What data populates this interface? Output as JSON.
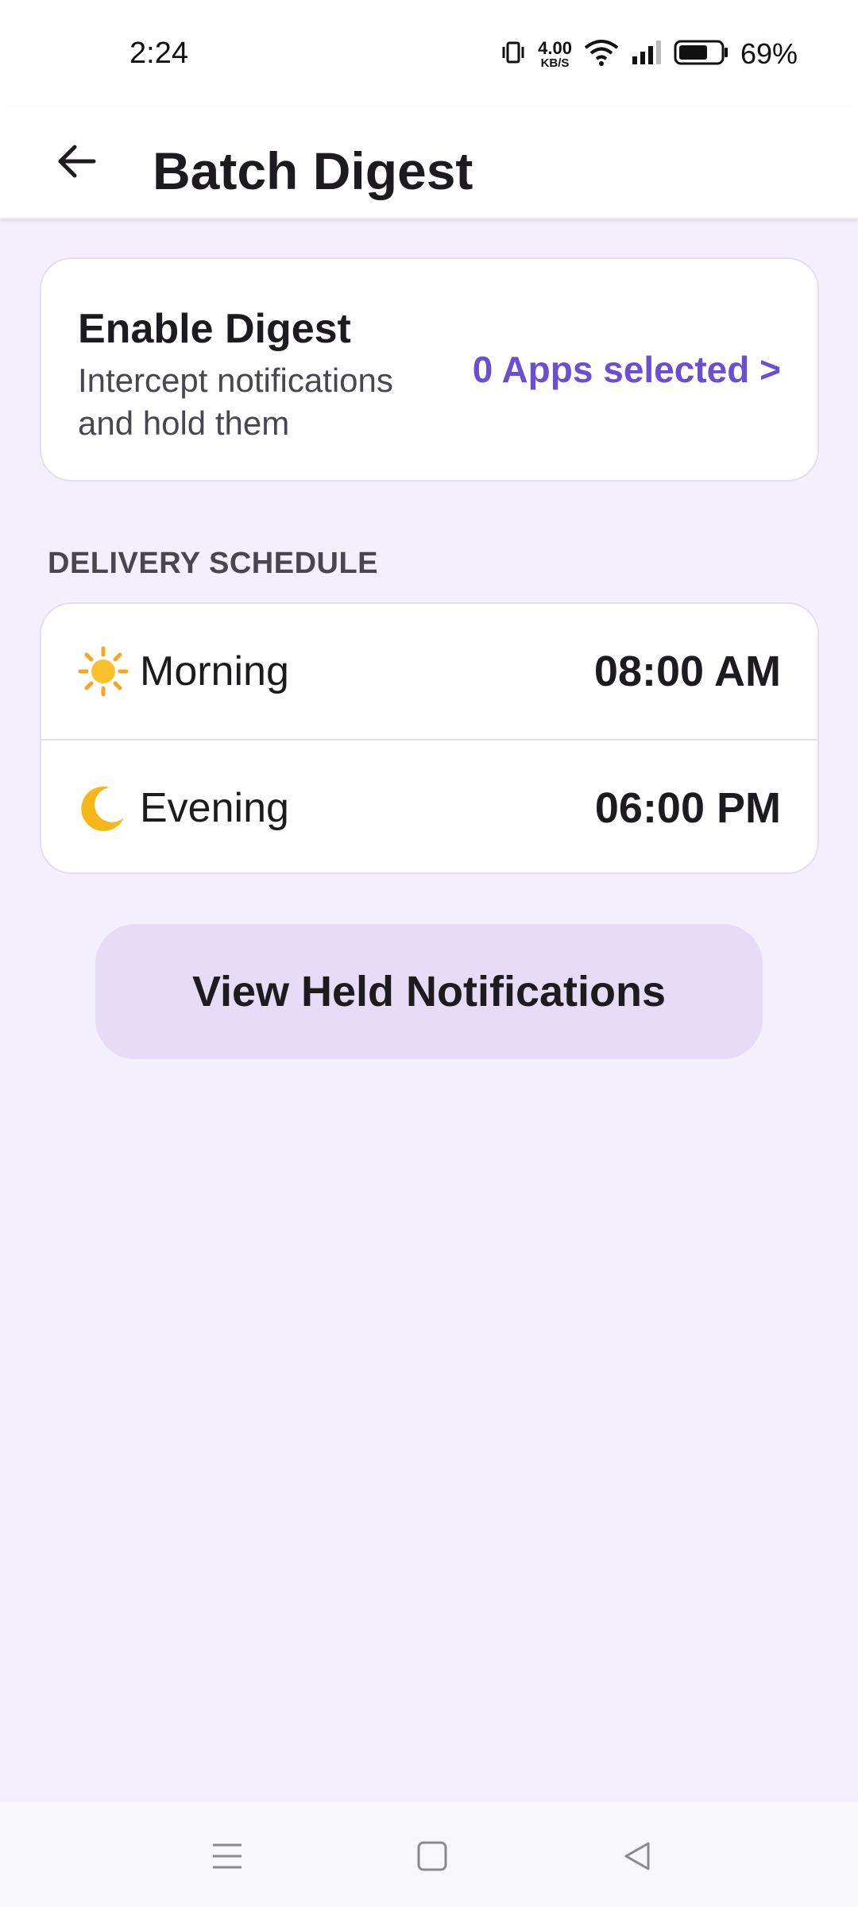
{
  "status_bar": {
    "time": "2:24",
    "net_speed_value": "4.00",
    "net_speed_unit": "KB/S",
    "battery_percent": "69%"
  },
  "app_bar": {
    "title": "Batch Digest",
    "back_icon": "arrow-left-icon"
  },
  "enable_card": {
    "title": "Enable Digest",
    "subtitle": "Intercept notifications and hold them",
    "apps_selected": "0 Apps selected >"
  },
  "schedule": {
    "section_label": "DELIVERY SCHEDULE",
    "rows": [
      {
        "icon": "sun-icon",
        "label": "Morning",
        "time": "08:00 AM"
      },
      {
        "icon": "moon-icon",
        "label": "Evening",
        "time": "06:00 PM"
      }
    ]
  },
  "actions": {
    "view_held": "View Held Notifications"
  },
  "colors": {
    "accent": "#6a4fd0",
    "background": "#f3effd",
    "button_bg": "#e7dcf5"
  }
}
